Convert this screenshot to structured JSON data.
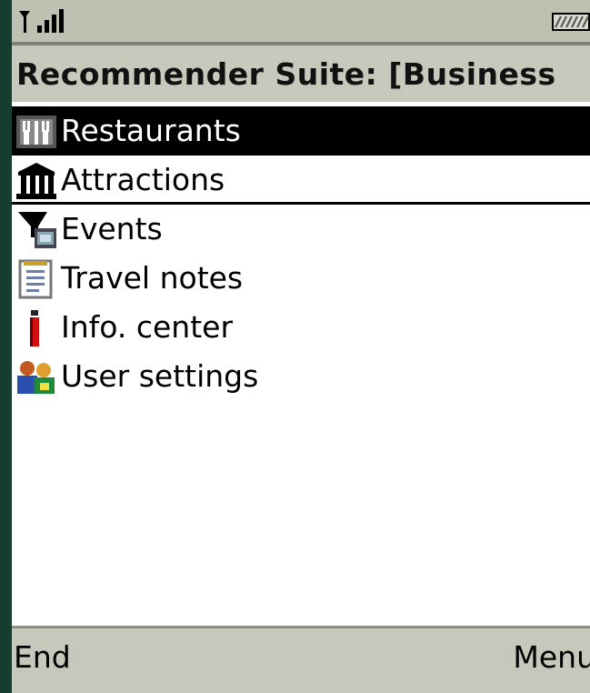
{
  "status_bar": {
    "signal_icon": "signal-strength-icon",
    "battery_icon": "battery-icon"
  },
  "title": "Recommender Suite: [Business",
  "menu": {
    "items": [
      {
        "label": "Restaurants",
        "icon": "fork-knife-icon",
        "selected": true
      },
      {
        "label": "Attractions",
        "icon": "landmark-icon",
        "selected": false
      },
      {
        "label": "Events",
        "icon": "events-icon",
        "selected": false
      },
      {
        "label": "Travel notes",
        "icon": "notepad-icon",
        "selected": false
      },
      {
        "label": "Info. center",
        "icon": "info-icon",
        "selected": false
      },
      {
        "label": "User settings",
        "icon": "users-icon",
        "selected": false
      }
    ]
  },
  "softkeys": {
    "left": "End",
    "right": "Menu"
  }
}
